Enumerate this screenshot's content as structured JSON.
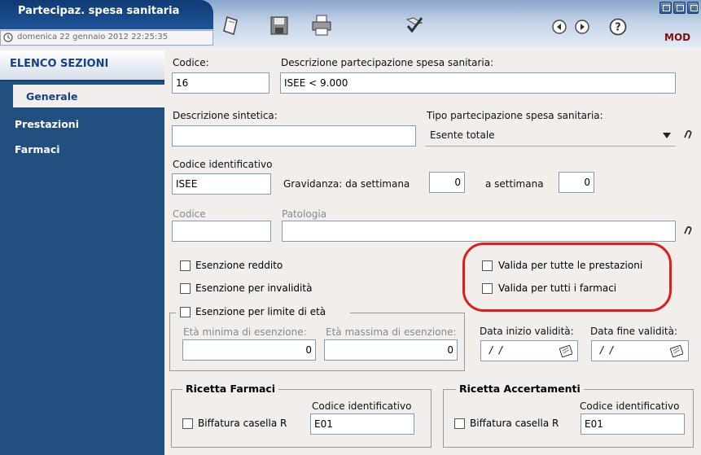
{
  "window": {
    "title": "Partecipaz. spesa sanitaria",
    "datetime": "domenica 22 gennaio 2012  22:25:35",
    "mode": "MOD"
  },
  "icons": {
    "toolbar": [
      "new-document-icon",
      "save-icon",
      "print-icon",
      "confirm-check-icon"
    ],
    "nav": [
      "back-icon",
      "forward-icon",
      "help-icon"
    ]
  },
  "sidebar": {
    "header": "ELENCO SEZIONI",
    "items": [
      {
        "label": "Generale",
        "active": true
      },
      {
        "label": "Prestazioni",
        "active": false
      },
      {
        "label": "Farmaci",
        "active": false
      }
    ]
  },
  "form": {
    "codice_label": "Codice:",
    "codice_value": "16",
    "descrizione_label": "Descrizione partecipazione spesa sanitaria:",
    "descrizione_value": "ISEE < 9.000",
    "sintetica_label": "Descrizione sintetica:",
    "sintetica_value": "",
    "tipo_label": "Tipo partecipazione spesa sanitaria:",
    "tipo_value": "Esente totale",
    "codice_id_label": "Codice identificativo",
    "codice_id_value": "ISEE",
    "gravidanza_label": "Gravidanza:  da settimana",
    "gravidanza_da": "0",
    "a_settimana_label": "a settimana",
    "gravidanza_a": "0",
    "patologia_codice_label": "Codice",
    "patologia_codice_value": "",
    "patologia_label": "Patologia",
    "patologia_value": "",
    "esenzione_reddito": "Esenzione reddito",
    "esenzione_invalidita": "Esenzione per invalidità",
    "esenzione_eta": "Esenzione per limite di età",
    "eta_min_label": "Età minima di esenzione:",
    "eta_min_value": "0",
    "eta_max_label": "Età massima di esenzione:",
    "eta_max_value": "0",
    "valida_prestazioni": "Valida per tutte le prestazioni",
    "valida_farmaci": "Valida per tutti i farmaci",
    "data_inizio_label": "Data inizio validità:",
    "data_inizio_value": "/ /",
    "data_fine_label": "Data fine validità:",
    "data_fine_value": "/ /"
  },
  "ricetta_farmaci": {
    "title": "Ricetta Farmaci",
    "codice_label": "Codice identificativo",
    "codice_value": "E01",
    "biffatura": "Biffatura casella R"
  },
  "ricetta_accertamenti": {
    "title": "Ricetta Accertamenti",
    "codice_label": "Codice identificativo",
    "codice_value": "E01",
    "biffatura": "Biffatura casella R"
  },
  "colors": {
    "title_blue": "#1f5498",
    "sidebar_blue": "#204f80",
    "highlight_red": "#e21b1b",
    "mode_red": "#7a0f0f"
  }
}
